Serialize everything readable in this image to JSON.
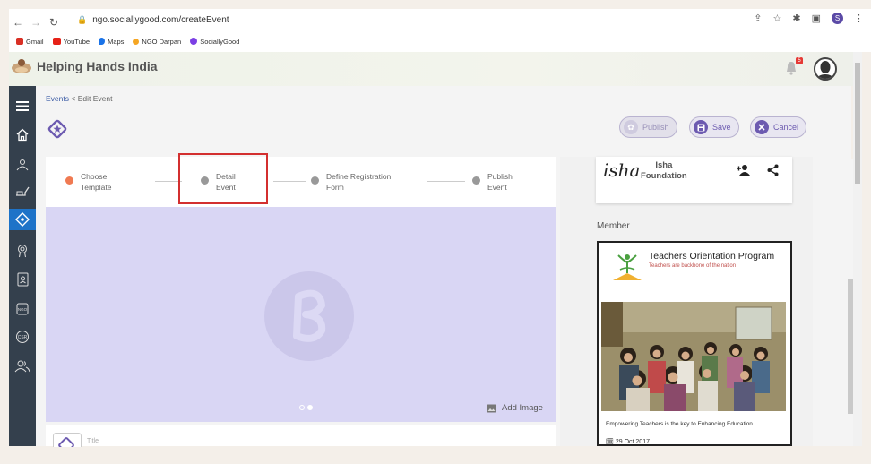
{
  "browser": {
    "url": "ngo.sociallygood.com/createEvent",
    "profile_initial": "S",
    "bookmarks": [
      {
        "label": "Gmail",
        "color": "#d93025"
      },
      {
        "label": "YouTube",
        "color": "#e62117"
      },
      {
        "label": "Maps",
        "color": "#1a73e8"
      },
      {
        "label": "NGO Darpan",
        "color": "#f5a623"
      },
      {
        "label": "SociallyGood",
        "color": "#7b3fe4"
      }
    ]
  },
  "app": {
    "brand": "Helping Hands India",
    "notification_count": "5"
  },
  "breadcrumb": {
    "parent": "Events",
    "separator": "<",
    "current": "Edit Event"
  },
  "actions": {
    "publish": "Publish",
    "save": "Save",
    "cancel": "Cancel"
  },
  "steps": [
    {
      "line1": "Choose",
      "line2": "Template",
      "state": "done"
    },
    {
      "line1": "Detail",
      "line2": "Event",
      "state": "pending"
    },
    {
      "line1": "Define Registration",
      "line2": "Form",
      "state": "pending"
    },
    {
      "line1": "Publish",
      "line2": "Event",
      "state": "pending"
    }
  ],
  "image_area": {
    "add_image": "Add Image"
  },
  "title_field": {
    "placeholder": "Title"
  },
  "org": {
    "signature": "isha",
    "name_line1": "Isha",
    "name_line2": "Foundation"
  },
  "member": {
    "label": "Member",
    "card_title": "Teachers Orientation Program",
    "card_subtitle": "Teachers are backbone of the nation",
    "caption": "Empowering Teachers is the key to Enhancing Education",
    "date": "29 Oct 2017"
  },
  "colors": {
    "sidebar": "#34404d",
    "sidebar_active": "#1e73c8",
    "accent": "#6c5ab0",
    "step_done": "#f07a52",
    "highlight": "#d32f2f"
  }
}
